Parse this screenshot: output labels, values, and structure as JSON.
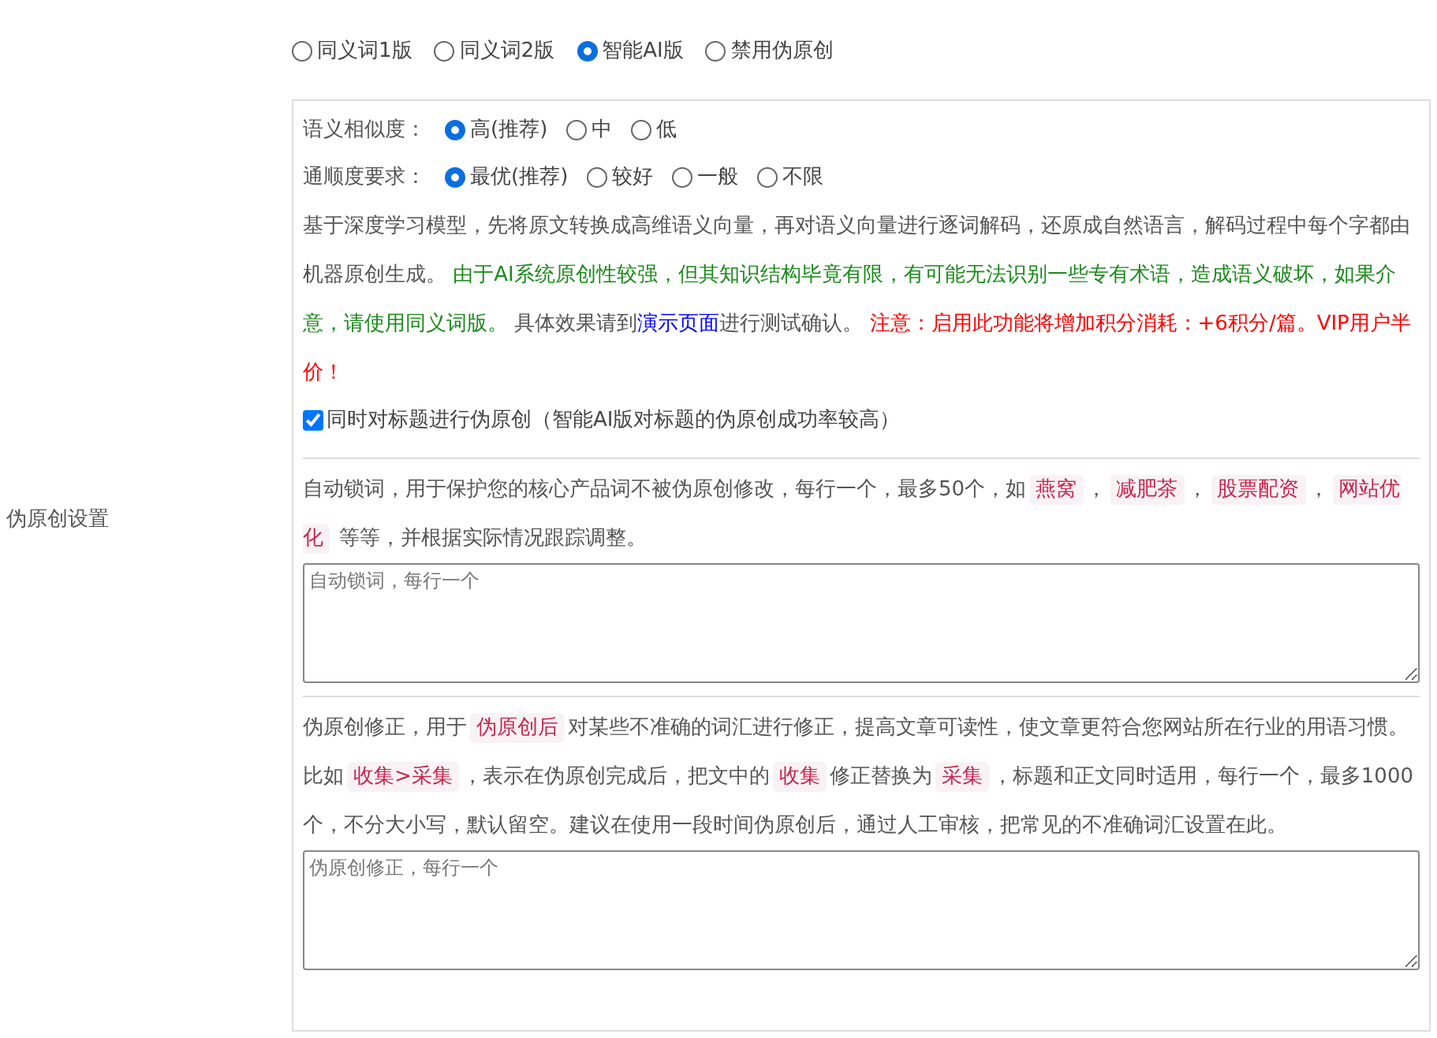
{
  "settings_label": "伪原创设置",
  "versions": [
    {
      "label": "同义词1版",
      "selected": false
    },
    {
      "label": "同义词2版",
      "selected": false
    },
    {
      "label": "智能AI版",
      "selected": true
    },
    {
      "label": "禁用伪原创",
      "selected": false
    }
  ],
  "similarity": {
    "label": "语义相似度：",
    "options": [
      {
        "label": "高(推荐)",
        "selected": true
      },
      {
        "label": "中",
        "selected": false
      },
      {
        "label": "低",
        "selected": false
      }
    ]
  },
  "fluency": {
    "label": "通顺度要求：",
    "options": [
      {
        "label": "最优(推荐)",
        "selected": true
      },
      {
        "label": "较好",
        "selected": false
      },
      {
        "label": "一般",
        "selected": false
      },
      {
        "label": "不限",
        "selected": false
      }
    ]
  },
  "description": [
    {
      "kind": "plain",
      "text": "基于深度学习模型，先将原文转换成高维语义向量，再对语义向量进行逐词解码，还原成自然语言，解码过程中每个字都由机器原创生成。 "
    },
    {
      "kind": "green",
      "text": "由于AI系统原创性较强，但其知识结构毕竟有限，有可能无法识别一些专有术语，造成语义破坏，如果介意，请使用同义词版。"
    },
    {
      "kind": "plain",
      "text": " 具体效果请到"
    },
    {
      "kind": "link",
      "text": "演示页面"
    },
    {
      "kind": "plain",
      "text": "进行测试确认。 "
    },
    {
      "kind": "red",
      "text": "注意：启用此功能将增加积分消耗：+6积分/篇。VIP用户半价！"
    }
  ],
  "title_option": {
    "label": "同时对标题进行伪原创（智能AI版对标题的伪原创成功率较高）",
    "checked": true
  },
  "lock_words": {
    "description": [
      {
        "kind": "plain",
        "text": "自动锁词，用于保护您的核心产品词不被伪原创修改，每行一个，最多50个，如"
      },
      {
        "kind": "code",
        "text": "燕窝"
      },
      {
        "kind": "plain",
        "text": "，"
      },
      {
        "kind": "code",
        "text": "减肥茶"
      },
      {
        "kind": "plain",
        "text": "，"
      },
      {
        "kind": "code",
        "text": "股票配资"
      },
      {
        "kind": "plain",
        "text": "，"
      },
      {
        "kind": "code",
        "text": "网站优化"
      },
      {
        "kind": "plain",
        "text": " 等等，并根据实际情况跟踪调整。"
      }
    ],
    "placeholder": "自动锁词，每行一个"
  },
  "corrections": {
    "description": [
      {
        "kind": "plain",
        "text": "伪原创修正，用于"
      },
      {
        "kind": "code",
        "text": "伪原创后"
      },
      {
        "kind": "plain",
        "text": "对某些不准确的词汇进行修正，提高文章可读性，使文章更符合您网站所在行业的用语习惯。比如"
      },
      {
        "kind": "code",
        "text": "收集>采集"
      },
      {
        "kind": "plain",
        "text": "，表示在伪原创完成后，把文中的"
      },
      {
        "kind": "code",
        "text": "收集"
      },
      {
        "kind": "plain",
        "text": "修正替换为"
      },
      {
        "kind": "code",
        "text": "采集"
      },
      {
        "kind": "plain",
        "text": "，标题和正文同时适用，每行一个，最多1000个，不分大小写，默认留空。建议在使用一段时间伪原创后，通过人工审核，把常见的不准确词汇设置在此。"
      }
    ],
    "placeholder": "伪原创修正，每行一个"
  }
}
